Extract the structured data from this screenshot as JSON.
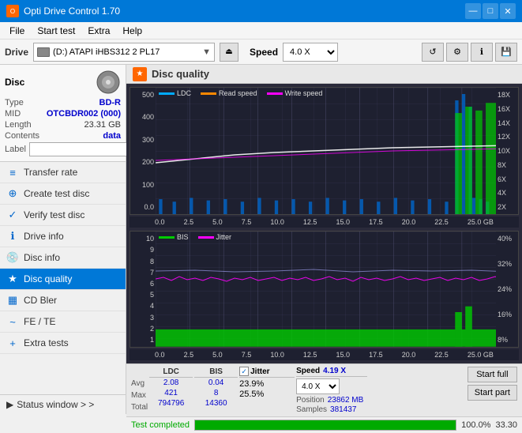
{
  "titleBar": {
    "title": "Opti Drive Control 1.70",
    "minimizeLabel": "—",
    "maximizeLabel": "□",
    "closeLabel": "✕"
  },
  "menuBar": {
    "items": [
      "File",
      "Start test",
      "Extra",
      "Help"
    ]
  },
  "driveBar": {
    "label": "Drive",
    "driveText": "(D:) ATAPI iHBS312  2 PL17",
    "speedLabel": "Speed",
    "speedValue": "4.0 X"
  },
  "discInfo": {
    "title": "Disc",
    "typeLabel": "Type",
    "typeValue": "BD-R",
    "midLabel": "MID",
    "midValue": "OTCBDR002 (000)",
    "lengthLabel": "Length",
    "lengthValue": "23.31 GB",
    "contentsLabel": "Contents",
    "contentsValue": "data",
    "labelLabel": "Label",
    "labelValue": ""
  },
  "navItems": [
    {
      "id": "transfer-rate",
      "label": "Transfer rate",
      "icon": "≡"
    },
    {
      "id": "create-test-disc",
      "label": "Create test disc",
      "icon": "⊕"
    },
    {
      "id": "verify-test-disc",
      "label": "Verify test disc",
      "icon": "✓"
    },
    {
      "id": "drive-info",
      "label": "Drive info",
      "icon": "ℹ"
    },
    {
      "id": "disc-info",
      "label": "Disc info",
      "icon": "💿"
    },
    {
      "id": "disc-quality",
      "label": "Disc quality",
      "icon": "★",
      "active": true
    },
    {
      "id": "cd-bler",
      "label": "CD Bler",
      "icon": "▦"
    },
    {
      "id": "fe-te",
      "label": "FE / TE",
      "icon": "~"
    },
    {
      "id": "extra-tests",
      "label": "Extra tests",
      "icon": "+"
    }
  ],
  "statusWindow": {
    "label": "Status window > >"
  },
  "discQuality": {
    "title": "Disc quality",
    "legend": {
      "ldc": "LDC",
      "readSpeed": "Read speed",
      "writeSpeed": "Write speed"
    },
    "legendBottom": {
      "bis": "BIS",
      "jitter": "Jitter"
    },
    "topYAxis": [
      "500",
      "400",
      "300",
      "200",
      "100"
    ],
    "topYAxisRight": [
      "18X",
      "16X",
      "14X",
      "12X",
      "10X",
      "8X",
      "6X",
      "4X",
      "2X"
    ],
    "bottomYAxis": [
      "10",
      "9",
      "8",
      "7",
      "6",
      "5",
      "4",
      "3",
      "2",
      "1"
    ],
    "bottomYAxisRight": [
      "40%",
      "32%",
      "24%",
      "16%",
      "8%"
    ],
    "xAxisLabels": [
      "0.0",
      "2.5",
      "5.0",
      "7.5",
      "10.0",
      "12.5",
      "15.0",
      "17.5",
      "20.0",
      "22.5",
      "25.0 GB"
    ]
  },
  "stats": {
    "ldcLabel": "LDC",
    "bisLabel": "BIS",
    "jitterLabel": "Jitter",
    "speedLabel": "Speed",
    "avgLabel": "Avg",
    "maxLabel": "Max",
    "totalLabel": "Total",
    "positionLabel": "Position",
    "samplesLabel": "Samples",
    "ldcAvg": "2.08",
    "ldcMax": "421",
    "ldcTotal": "794796",
    "bisAvg": "0.04",
    "bisMax": "8",
    "bisTotal": "14360",
    "jitterAvg": "23.9%",
    "jitterMax": "25.5%",
    "speedValue": "4.19 X",
    "speedSelect": "4.0 X",
    "position": "23862 MB",
    "samples": "381437",
    "startFullLabel": "Start full",
    "startPartLabel": "Start part"
  },
  "progressBar": {
    "percent": 100,
    "statusText": "Test completed",
    "timeText": "33.30"
  }
}
